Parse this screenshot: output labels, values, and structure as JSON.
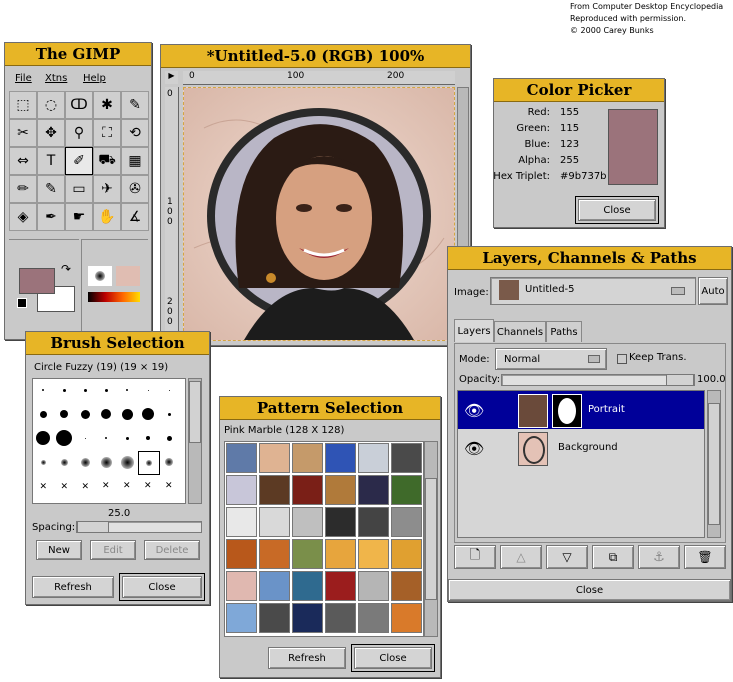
{
  "credit": {
    "line1": "From Computer Desktop Encyclopedia",
    "line2": "Reproduced with permission.",
    "line3": "© 2000 Carey Bunks"
  },
  "toolbox": {
    "title": "The GIMP",
    "menu": [
      "File",
      "Xtns",
      "Help"
    ],
    "tools": [
      "rect-select",
      "ellipse-select",
      "free-select",
      "fuzzy-select",
      "bezier-select",
      "scissors",
      "move",
      "magnify",
      "crop",
      "transform",
      "flip",
      "text",
      "color-picker",
      "bucket-fill",
      "blend",
      "pencil",
      "paintbrush",
      "eraser",
      "airbrush",
      "clone",
      "convolve",
      "ink",
      "smudge",
      "dodge-burn",
      "measure"
    ],
    "fg_color": "#9b737b",
    "bg_color": "#ffffff"
  },
  "image_window": {
    "title": "*Untitled-5.0 (RGB) 100%",
    "ruler_ticks": [
      "0",
      "100",
      "200"
    ],
    "vruler_ticks": [
      "0",
      "1 0 0",
      "2 0 0"
    ]
  },
  "color_picker": {
    "title": "Color Picker",
    "rows": [
      {
        "label": "Red:",
        "value": "155"
      },
      {
        "label": "Green:",
        "value": "115"
      },
      {
        "label": "Blue:",
        "value": "123"
      },
      {
        "label": "Alpha:",
        "value": "255"
      },
      {
        "label": "Hex Triplet:",
        "value": "#9b737b"
      }
    ],
    "swatch": "#9b737b",
    "close": "Close"
  },
  "layers": {
    "title": "Layers, Channels & Paths",
    "image_label": "Image:",
    "image_value": "Untitled-5",
    "auto": "Auto",
    "tabs": [
      "Layers",
      "Channels",
      "Paths"
    ],
    "mode_label": "Mode:",
    "mode_value": "Normal",
    "keep_trans": "Keep Trans.",
    "opacity_label": "Opacity:",
    "opacity_value": "100.0",
    "layer_rows": [
      {
        "name": "Portrait"
      },
      {
        "name": "Background"
      }
    ],
    "close": "Close"
  },
  "brush": {
    "title": "Brush Selection",
    "info": "Circle Fuzzy (19)  (19 × 19)",
    "spacing_value": "25.0",
    "spacing_label": "Spacing:",
    "spacing_fraction": 0.25,
    "new": "New",
    "edit": "Edit",
    "delete": "Delete",
    "refresh": "Refresh",
    "close": "Close"
  },
  "pattern": {
    "title": "Pattern Selection",
    "info": "Pink Marble  (128 X 128)",
    "refresh": "Refresh",
    "close": "Close",
    "swatches": [
      "#5f7aa8",
      "#dfb392",
      "#c59a6a",
      "#2f54b5",
      "#c9cfd8",
      "#4a4a4a",
      "#c8c6d9",
      "#5c3a23",
      "#7a1f17",
      "#b07a3a",
      "#2b2a4a",
      "#3f6a2a",
      "#e8e8e8",
      "#d9d9d9",
      "#bfbfbf",
      "#2c2c2c",
      "#444444",
      "#8d8d8d",
      "#b8581b",
      "#c86a26",
      "#7a8f4a",
      "#e7a53d",
      "#f0b54a",
      "#e0a030",
      "#e0b8b0",
      "#6a93c8",
      "#2f6a8f",
      "#9b1d1d",
      "#b5b5b5",
      "#a56028",
      "#7fa8d8",
      "#4a4a4a",
      "#1a2a5a",
      "#5a5a5a",
      "#7a7a7a",
      "#d97a2a"
    ]
  }
}
